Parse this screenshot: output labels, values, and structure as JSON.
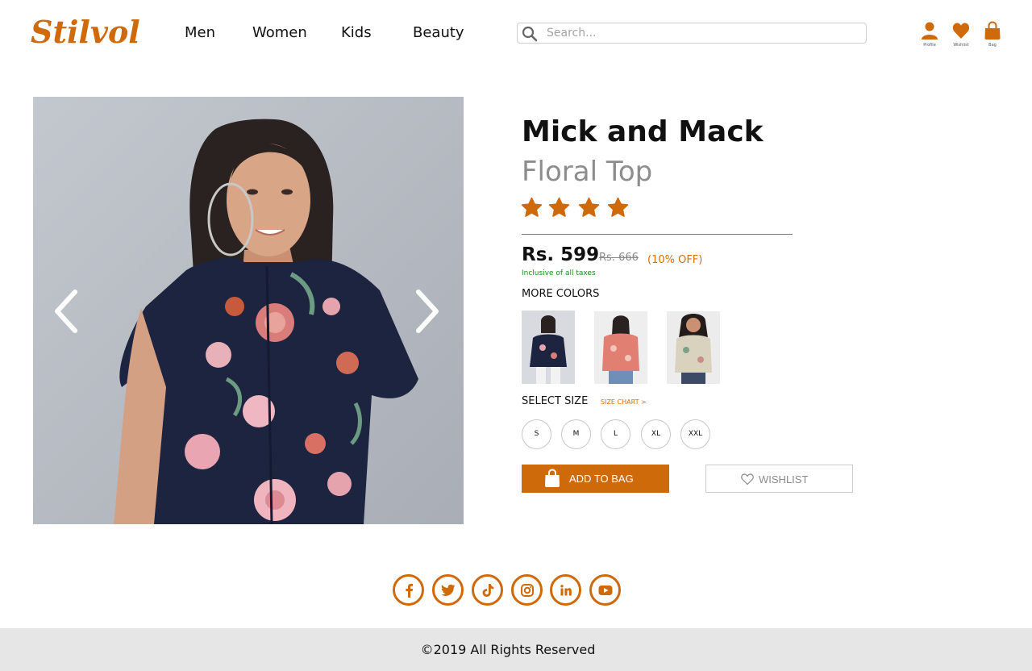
{
  "header": {
    "logo": "Stilvol",
    "nav": [
      "Men",
      "Women",
      "Kids",
      "Beauty"
    ],
    "search_placeholder": "Search...",
    "icons": [
      {
        "label": "Profile",
        "icon": "profile-icon"
      },
      {
        "label": "Wishlist",
        "icon": "heart-icon"
      },
      {
        "label": "Bag",
        "icon": "bag-icon"
      }
    ]
  },
  "product": {
    "brand": "Mick and Mack",
    "name": "Floral Top",
    "rating": 4,
    "price": "Rs. 599",
    "mrp": "Rs. 666",
    "discount": "(10% OFF)",
    "tax_note": "Inclusive of all taxes",
    "more_colors_label": "MORE COLORS",
    "colors": [
      "navy-floral",
      "coral-floral",
      "beige-floral"
    ],
    "select_size_label": "SELECT SIZE",
    "size_chart_label": "SIZE CHART >",
    "sizes": [
      "S",
      "M",
      "L",
      "XL",
      "XXL"
    ],
    "add_to_bag_label": "ADD TO BAG",
    "wishlist_label": "WISHLIST"
  },
  "social": [
    "facebook-icon",
    "twitter-icon",
    "tiktok-icon",
    "instagram-icon",
    "linkedin-icon",
    "youtube-icon"
  ],
  "footer": {
    "copyright": "©2019 All Rights Reserved"
  },
  "colors": {
    "accent": "#cf6a0b",
    "discount": "#d4700c",
    "tax": "#1f8a1f",
    "footer_bg": "#e6e6e6"
  }
}
